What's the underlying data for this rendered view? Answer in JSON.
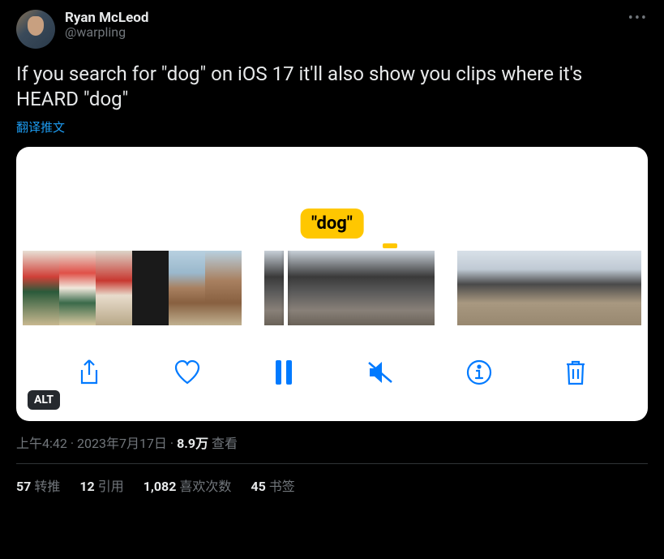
{
  "author": {
    "display_name": "Ryan McLeod",
    "handle": "@warpling"
  },
  "tweet_text": "If you search for \"dog\" on iOS 17 it'll also show you clips where it's HEARD \"dog\"",
  "translate_label": "翻译推文",
  "media": {
    "search_chip": "\"dog\"",
    "alt_badge": "ALT"
  },
  "meta": {
    "time": "上午4:42",
    "date": "2023年7月17日",
    "views_count": "8.9万",
    "views_label": "查看",
    "sep": " · "
  },
  "stats": {
    "retweet_count": "57",
    "retweet_label": "转推",
    "quote_count": "12",
    "quote_label": "引用",
    "like_count": "1,082",
    "like_label": "喜欢次数",
    "bookmark_count": "45",
    "bookmark_label": "书签"
  }
}
